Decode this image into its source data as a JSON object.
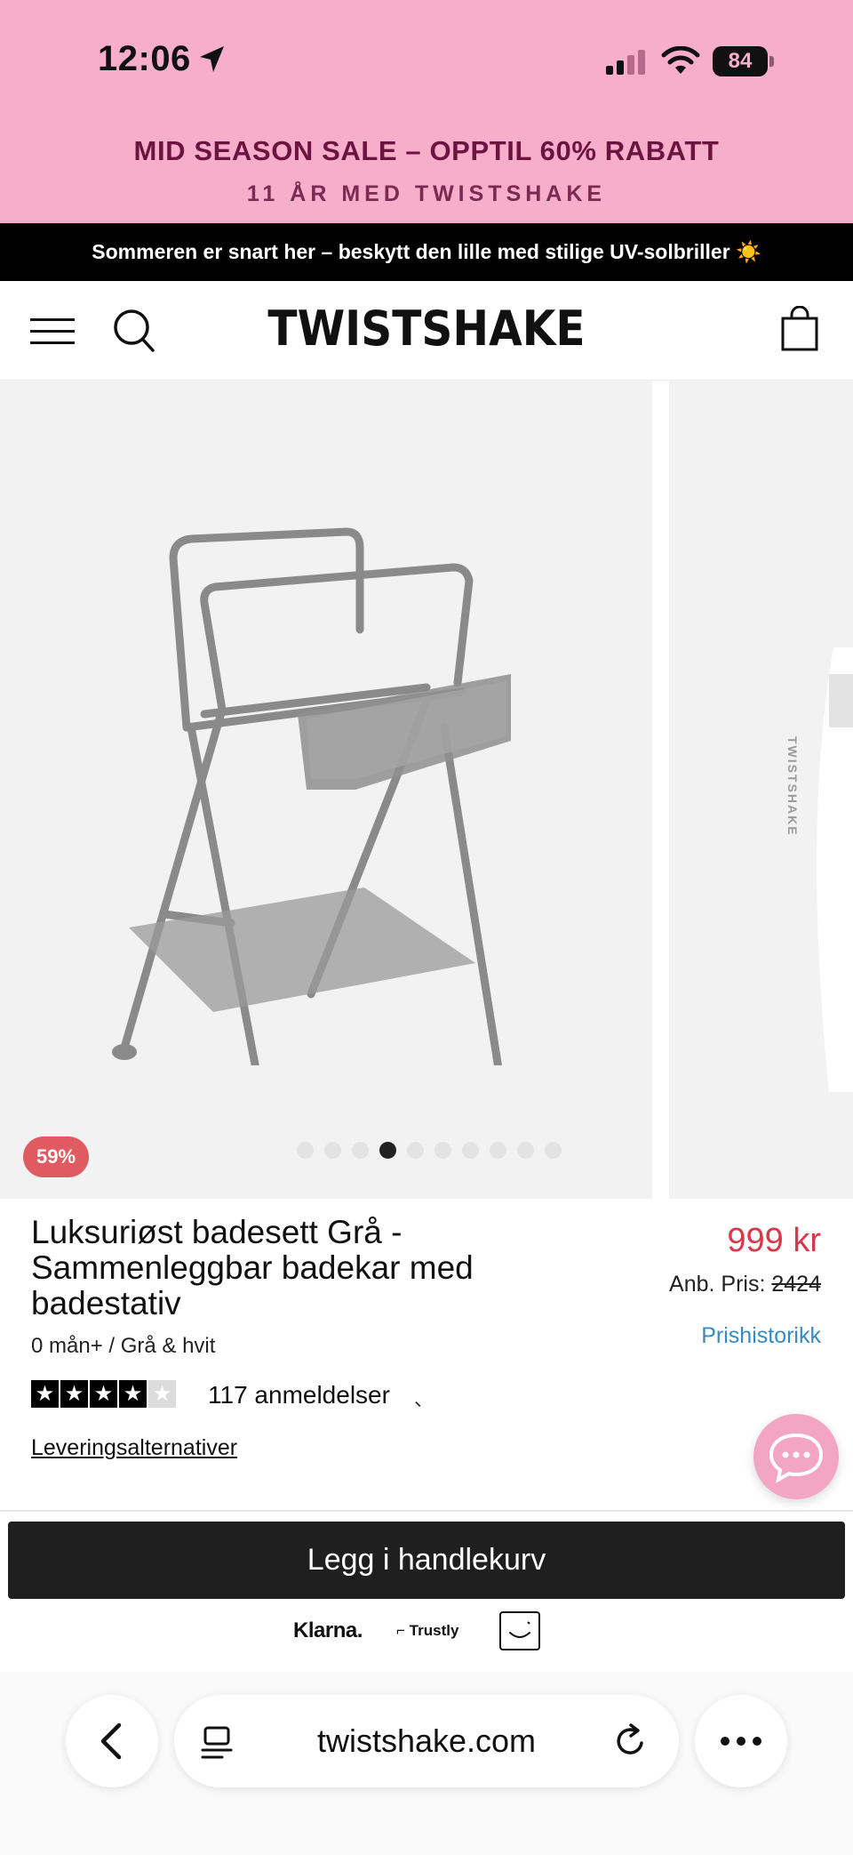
{
  "status_bar": {
    "time": "12:06",
    "battery": "84",
    "icons": [
      "location-arrow-icon",
      "cellular-signal-icon",
      "wifi-icon",
      "battery-icon"
    ]
  },
  "promo": {
    "title": "MID SEASON SALE – OPPTIL 60% RABATT",
    "subtitle": "11 ÅR MED TWISTSHAKE",
    "background_color": "#f6aecb"
  },
  "announcement": {
    "text": "Sommeren er snart her – beskytt den lille med stilige UV-solbriller ☀️"
  },
  "header": {
    "logo": "TWISTSHAKE",
    "icons": [
      "menu-icon",
      "search-icon",
      "shopping-bag-icon"
    ]
  },
  "gallery": {
    "discount_badge": "59%",
    "image_count": 10,
    "active_index": 3,
    "next_slide_wordmark": "TWISTSHAKE"
  },
  "product": {
    "title": "Luksuriøst badesett Grå - Sammenleggbar badekar med badestativ",
    "variant": "0 mån+ / Grå & hvit",
    "price": "999 kr",
    "compare_label": "Anb. Pris:",
    "compare_price": "2424",
    "price_history_link": "Prishistorikk",
    "rating": 4,
    "rating_max": 5,
    "reviews": "117 anmeldelser",
    "reviews_mark": "、",
    "delivery_link": "Leveringsalternativer",
    "accent_color": "#d8384a"
  },
  "cart": {
    "add_to_cart_label": "Legg i handlekurv"
  },
  "payments": {
    "klarna": "Klarna.",
    "trustly": "Trustly"
  },
  "browser": {
    "url": "twistshake.com",
    "icons": [
      "back-chevron-icon",
      "tabs-icon",
      "reload-icon",
      "more-dots-icon"
    ]
  }
}
